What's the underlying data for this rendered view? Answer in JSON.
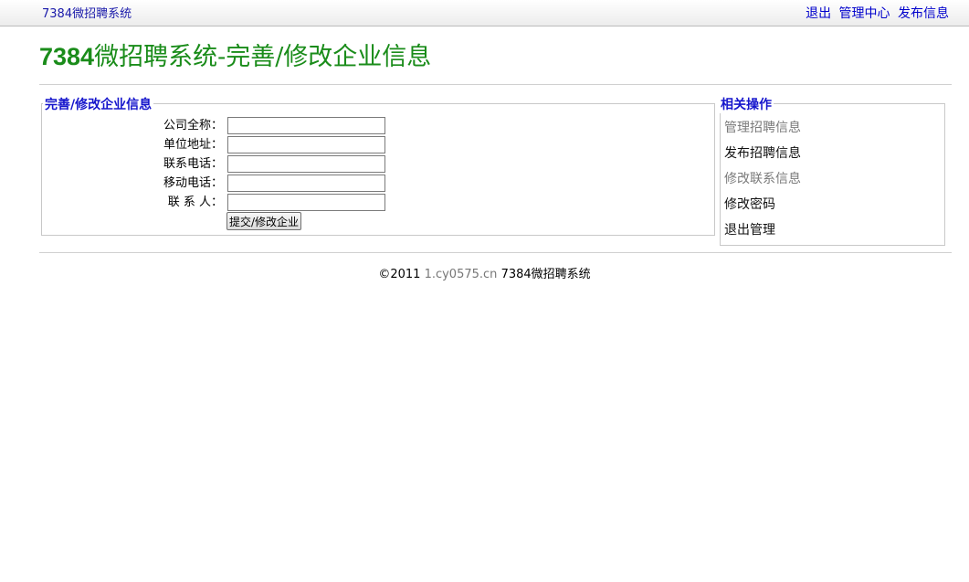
{
  "topbar": {
    "site_name": "7384微招聘系统",
    "links": [
      {
        "label": "退出"
      },
      {
        "label": "管理中心"
      },
      {
        "label": "发布信息"
      }
    ]
  },
  "page": {
    "title_prefix": "7384",
    "title_rest": "微招聘系统-完善/修改企业信息"
  },
  "form": {
    "legend": "完善/修改企业信息",
    "fields": [
      {
        "label": "公司全称：",
        "value": ""
      },
      {
        "label": "单位地址：",
        "value": ""
      },
      {
        "label": "联系电话：",
        "value": ""
      },
      {
        "label": "移动电话：",
        "value": ""
      },
      {
        "label": "联 系 人：",
        "value": ""
      }
    ],
    "submit_label": "提交/修改企业"
  },
  "sidebar": {
    "legend": "相关操作",
    "items": [
      {
        "label": "管理招聘信息"
      },
      {
        "label": "发布招聘信息"
      },
      {
        "label": "修改联系信息"
      },
      {
        "label": "修改密码"
      },
      {
        "label": "退出管理"
      }
    ]
  },
  "footer": {
    "copyright": "©2011",
    "host": "1.cy0575.cn",
    "name": "7384微招聘系统"
  },
  "colors": {
    "title_green": "#1a8c1a",
    "link_blue": "#0000cc",
    "legend_blue": "#1515cc",
    "muted_gray": "#7a7a7a"
  }
}
